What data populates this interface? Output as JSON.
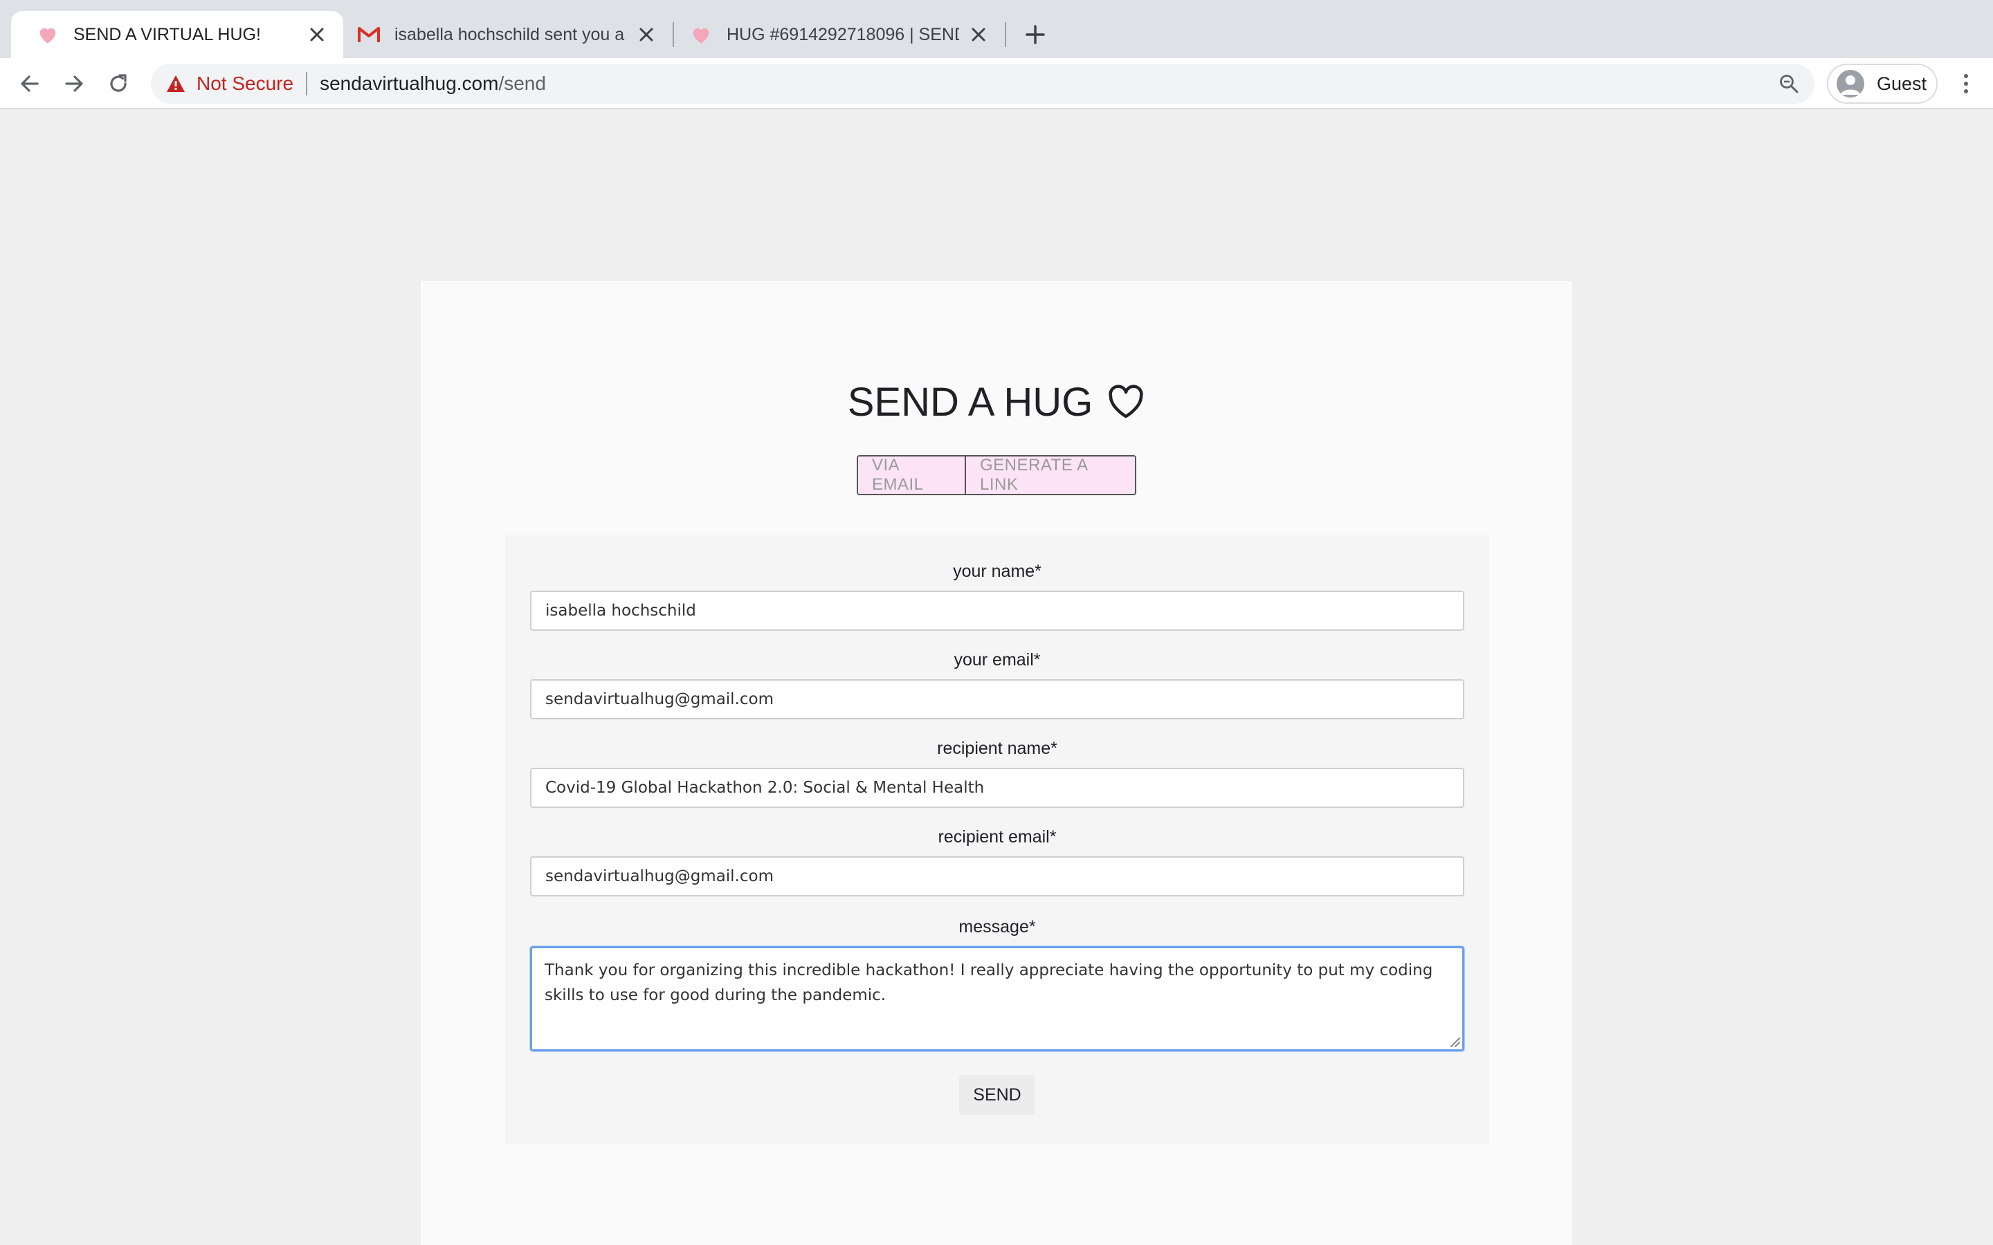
{
  "browser": {
    "tabs": [
      {
        "title": "SEND A VIRTUAL HUG!",
        "active": true,
        "favicon": "heart-icon"
      },
      {
        "title": "isabella hochschild sent you a",
        "active": false,
        "favicon": "gmail-icon"
      },
      {
        "title": "HUG #6914292718096 | SEND",
        "active": false,
        "favicon": "heart-icon"
      }
    ],
    "security_label": "Not Secure",
    "url_host": "sendavirtualhug.com",
    "url_path": "/send",
    "profile_label": "Guest"
  },
  "page": {
    "heading": "SEND A HUG",
    "modes": [
      {
        "label": "VIA EMAIL"
      },
      {
        "label": "GENERATE A LINK"
      }
    ],
    "form": {
      "sender_name": {
        "label": "your name*",
        "value": "isabella hochschild"
      },
      "sender_email": {
        "label": "your email*",
        "value": "sendavirtualhug@gmail.com"
      },
      "recipient_name": {
        "label": "recipient name*",
        "value": "Covid-19 Global Hackathon 2.0: Social & Mental Health"
      },
      "recipient_email": {
        "label": "recipient email*",
        "value": "sendavirtualhug@gmail.com"
      },
      "message": {
        "label": "message*",
        "value": "Thank you for organizing this incredible hackathon! I really appreciate having the opportunity to put my coding skills to use for good during the pandemic."
      },
      "send_label": "SEND"
    }
  },
  "colors": {
    "mode_bg": "#fce4f6",
    "focus_border": "#6d9eeb",
    "warning_red": "#c5221f",
    "favicon_pink": "#f4a7b9"
  }
}
